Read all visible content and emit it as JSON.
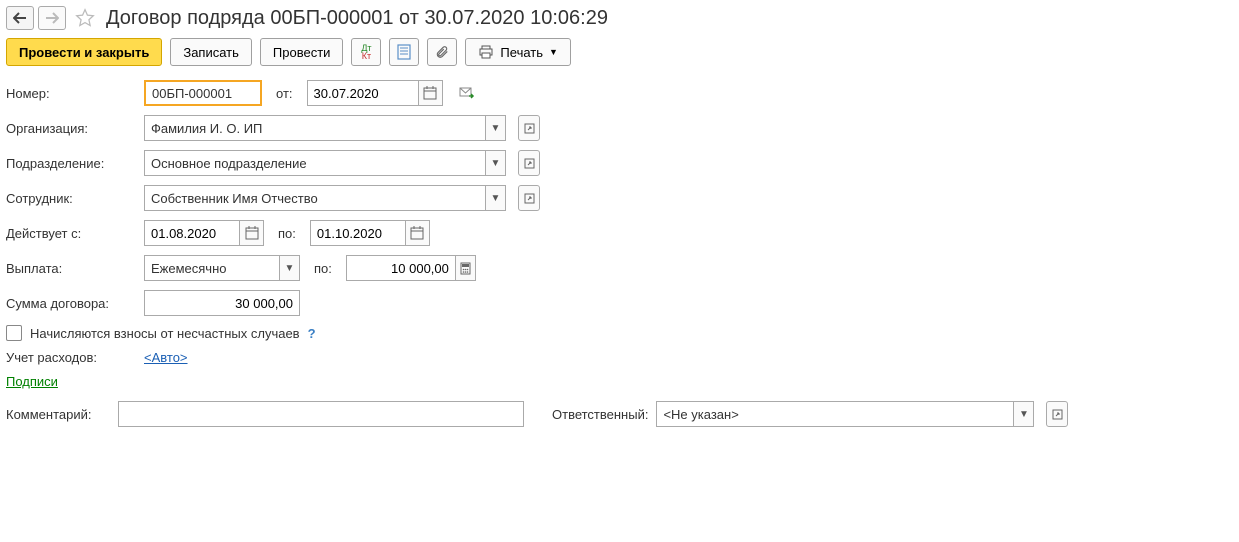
{
  "header": {
    "title": "Договор подряда 00БП-000001 от 30.07.2020 10:06:29"
  },
  "toolbar": {
    "post_close": "Провести и закрыть",
    "save": "Записать",
    "post": "Провести",
    "print": "Печать"
  },
  "labels": {
    "number": "Номер:",
    "from": "от:",
    "organization": "Организация:",
    "department": "Подразделение:",
    "employee": "Сотрудник:",
    "valid_from": "Действует с:",
    "to": "по:",
    "payment": "Выплата:",
    "per": "по:",
    "sum": "Сумма договора:",
    "accident_fees": "Начисляются взносы от несчастных случаев",
    "expense_accounting": "Учет расходов:",
    "signatures": "Подписи",
    "comment": "Комментарий:",
    "responsible": "Ответственный:"
  },
  "values": {
    "number": "00БП-000001",
    "date": "30.07.2020",
    "organization": "Фамилия И. О. ИП",
    "department": "Основное подразделение",
    "employee": "Собственник Имя Отчество",
    "valid_from": "01.08.2020",
    "valid_to": "01.10.2020",
    "payment": "Ежемесячно",
    "payment_amount": "10 000,00",
    "contract_sum": "30 000,00",
    "expense_auto": "<Авто>",
    "responsible": "<Не указан>",
    "comment": ""
  },
  "colors": {
    "primary_yellow": "#ffdb4d",
    "accent_orange": "#f5a623",
    "link_green": "#008000"
  }
}
